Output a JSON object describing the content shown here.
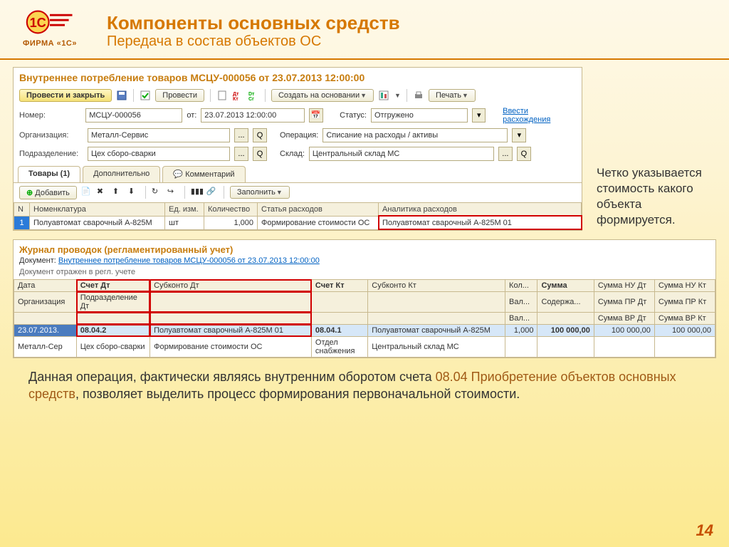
{
  "header": {
    "firma": "ФИРМА «1С»",
    "title": "Компоненты основных средств",
    "subtitle": "Передача в состав объектов ОС"
  },
  "doc": {
    "title": "Внутреннее потребление товаров МСЦУ-000056 от 23.07.2013 12:00:00",
    "toolbar": {
      "post_close": "Провести и закрыть",
      "post": "Провести",
      "base": "Создать на основании",
      "print": "Печать"
    },
    "fields": {
      "number_lbl": "Номер:",
      "number": "МСЦУ-000056",
      "from_lbl": "от:",
      "from": "23.07.2013 12:00:00",
      "status_lbl": "Статус:",
      "status": "Отгружено",
      "diff_link": "Ввести расхождения",
      "org_lbl": "Организация:",
      "org": "Металл-Сервис",
      "oper_lbl": "Операция:",
      "oper": "Списание на расходы / активы",
      "podr_lbl": "Подразделение:",
      "podr": "Цех сборо-сварки",
      "sklad_lbl": "Склад:",
      "sklad": "Центральный склад МС"
    },
    "tabs": {
      "goods": "Товары (1)",
      "addl": "Дополнительно",
      "comment": "Комментарий"
    },
    "goods_tb": {
      "add": "Добавить",
      "fill": "Заполнить"
    },
    "grid": {
      "cols": {
        "n": "N",
        "nom": "Номенклатура",
        "unit": "Ед. изм.",
        "qty": "Количество",
        "art": "Статья расходов",
        "anal": "Аналитика расходов"
      },
      "row": {
        "n": "1",
        "nom": "Полуавтомат сварочный А-825М",
        "unit": "шт",
        "qty": "1,000",
        "art": "Формирование стоимости ОС",
        "anal": "Полуавтомат сварочный А-825М   01"
      }
    }
  },
  "side_note": "Четко указывается стоимость какого объекта формируется.",
  "journal": {
    "title": "Журнал проводок (регламентированный учет)",
    "doc_lbl": "Документ:",
    "doc_link": "Внутреннее потребление товаров МСЦУ-000056 от 23.07.2013 12:00:00",
    "reflected": "Документ отражен в регл. учете",
    "cols": {
      "date": "Дата",
      "sdt": "Счет Дт",
      "sub_dt": "Субконто Дт",
      "skt": "Счет Кт",
      "sub_kt": "Субконто Кт",
      "kol": "Кол...",
      "sum": "Сумма",
      "snu_dt": "Сумма НУ Дт",
      "snu_kt": "Сумма НУ Кт",
      "org": "Организация",
      "podr": "Подразделение Дт",
      "val": "Вал...",
      "sod": "Содержа...",
      "spr_dt": "Сумма ПР Дт",
      "spr_kt": "Сумма ПР Кт",
      "vs": "Вал...",
      "svr_dt": "Сумма ВР Дт",
      "svr_kt": "Сумма ВР Кт"
    },
    "row1": {
      "date": "23.07.2013.",
      "sdt": "08.04.2",
      "sub_dt": "Полуавтомат сварочный А-825М   01",
      "skt": "08.04.1",
      "sub_kt": "Полуавтомат сварочный А-825М",
      "kol": "1,000",
      "sum": "100 000,00",
      "snu_dt": "100 000,00",
      "snu_kt": "100 000,00"
    },
    "row2": {
      "org": "Металл-Сер",
      "podr": "Цех сборо-сварки",
      "sub_dt2": "Формирование стоимости ОС",
      "skt2": "Отдел снабжения",
      "sub_kt2": "Центральный склад МС"
    }
  },
  "bottom": {
    "t1": "Данная операция, фактически являясь внутренним оборотом счета ",
    "acc": "08.04 Приобретение объектов основных средств",
    "t2": ", позволяет выделить процесс формирования первоначальной стоимости."
  },
  "page": "14"
}
